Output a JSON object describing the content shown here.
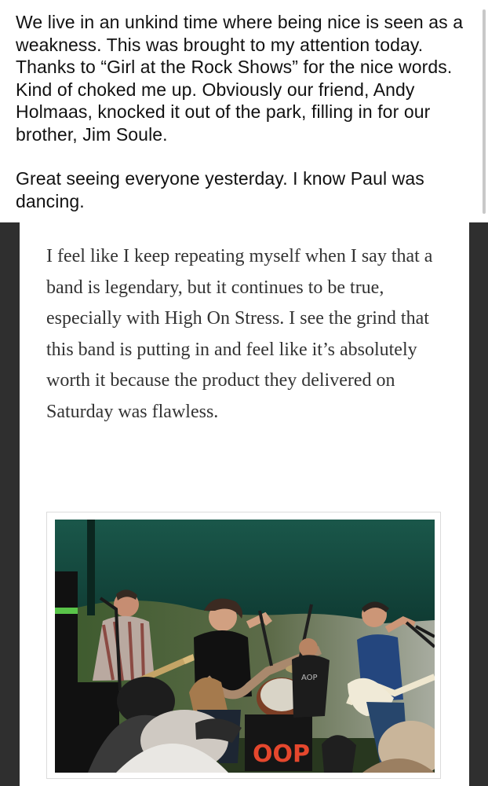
{
  "post": {
    "paragraph_1": "We live in an unkind time where being nice is seen as a weakness. This was brought to my attention today. Thanks to “Girl at the Rock Shows” for the nice words. Kind of choked me up. Obviously our friend, Andy Holmaas, knocked it out of the park, filling in for our brother, Jim Soule.",
    "paragraph_2": "Great seeing everyone yesterday. I know Paul was dancing."
  },
  "shared_article": {
    "quote": "I feel like I keep repeating myself when I say that a band is legendary, but it continues to be true, especially with High On Stress. I see the grind that this band is putting in and feel like it’s absolutely worth it because the product they delivered on Saturday was flawless.",
    "photo_icon": "band-performance-photo",
    "drum_text": "OOP"
  },
  "colors": {
    "canopy": "#1f5a4e",
    "background_dark": "#2f2f2f",
    "text": "#111111",
    "quote_text": "#333333"
  }
}
